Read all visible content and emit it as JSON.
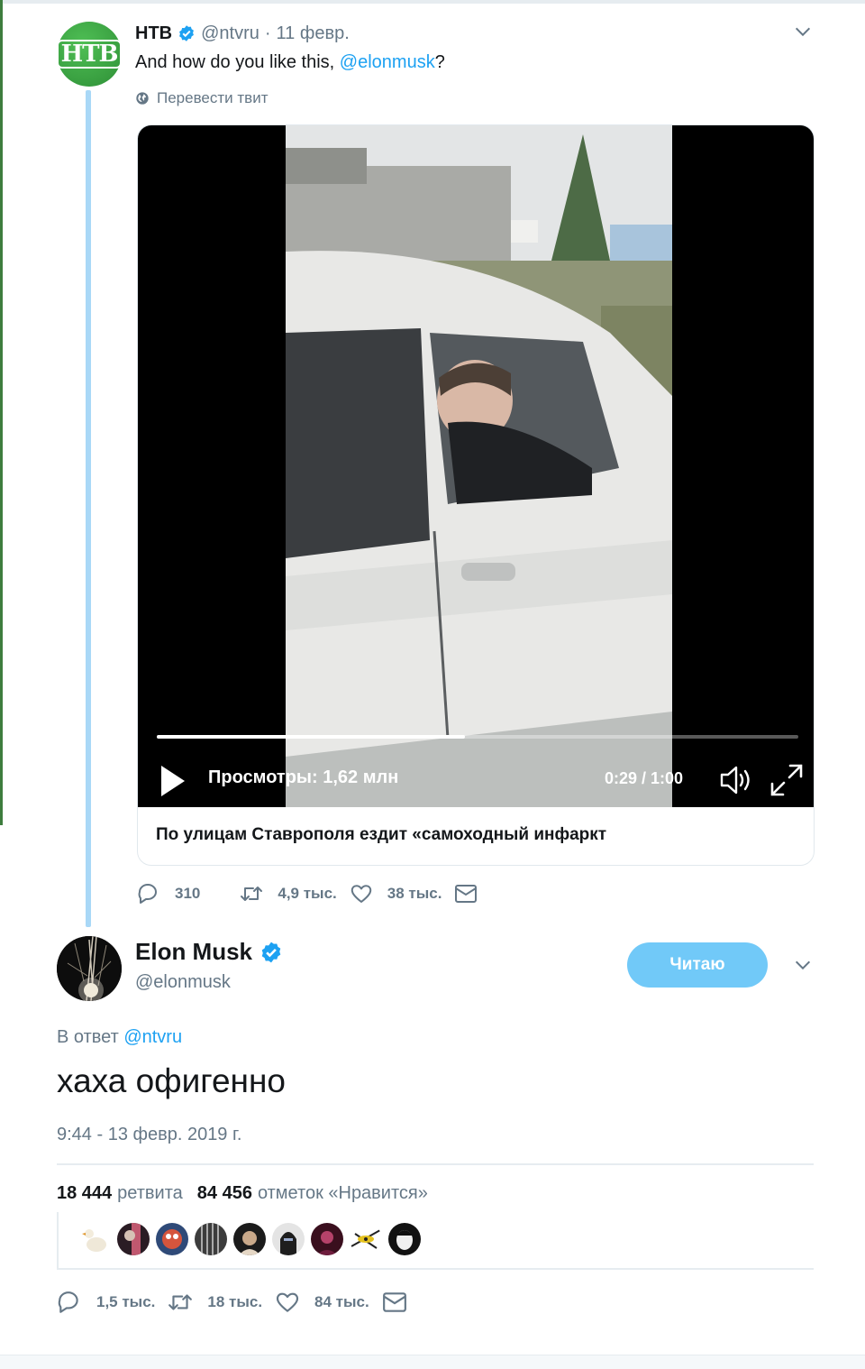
{
  "parent_tweet": {
    "author_name": "НТВ",
    "handle": "@ntvru",
    "separator": "·",
    "date": "11 февр.",
    "text_before": "And how do you like this, ",
    "mention": "@elonmusk",
    "text_after": "?",
    "translate_label": "Перевести твит",
    "video": {
      "progress": 0.48,
      "views_label": "Просмотры: 1,62 млн",
      "time": "0:29 / 1:00"
    },
    "card_title": "По улицам Ставрополя ездит «самоходный инфаркт",
    "actions": {
      "replies": "310",
      "retweets": "4,9 тыс.",
      "likes": "38 тыс."
    }
  },
  "main_tweet": {
    "author_name": "Elon Musk",
    "handle": "@elonmusk",
    "follow_label": "Читаю",
    "reply_prefix": "В ответ",
    "reply_mention": "@ntvru",
    "text": "хаха офигенно",
    "timestamp": "9:44 - 13 февр. 2019 г.",
    "stats": {
      "retweets_count": "18 444",
      "retweets_label": "ретвита",
      "likes_count": "84 456",
      "likes_label": "отметок «Нравится»"
    },
    "actions": {
      "replies": "1,5 тыс.",
      "retweets": "18 тыс.",
      "likes": "84 тыс."
    }
  },
  "colors": {
    "accent": "#1da1f2",
    "follow_button": "#71c9f8",
    "secondary_text": "#657786",
    "thread_line": "#a9d8f7",
    "ntv_green": "#2e8f36"
  },
  "icons": [
    "verified-badge-icon",
    "chevron-down-icon",
    "globe-icon",
    "play-icon",
    "volume-icon",
    "fullscreen-icon",
    "reply-icon",
    "retweet-icon",
    "like-icon",
    "message-icon"
  ]
}
